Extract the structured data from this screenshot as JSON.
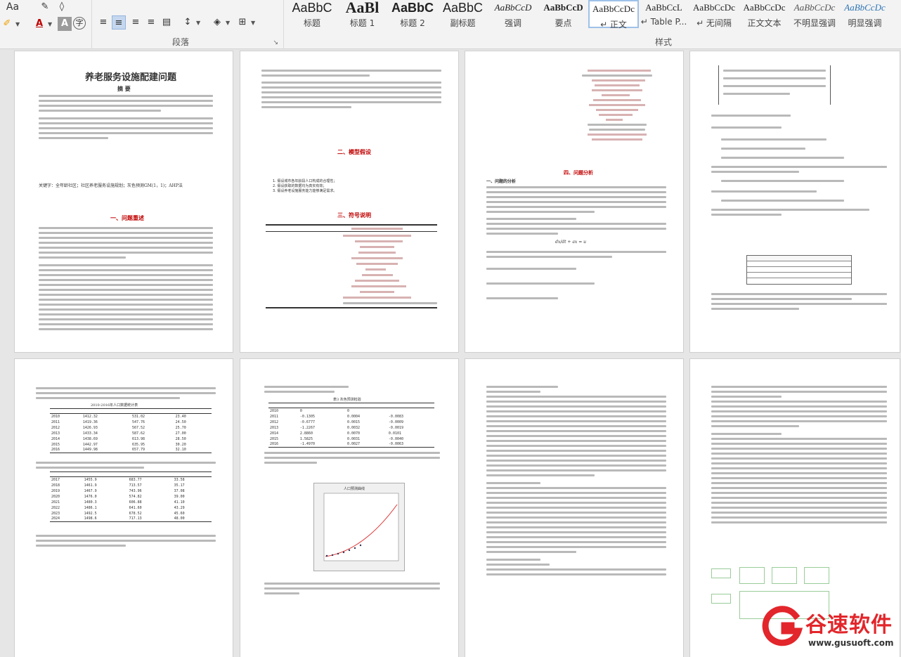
{
  "ribbon": {
    "font_group": {
      "label_partial": "Aa",
      "color_letter": "A",
      "shade_letter": "A",
      "char_letter": "字"
    },
    "paragraph_group": {
      "label": "段落"
    },
    "styles_group": {
      "label": "样式",
      "items": [
        {
          "preview": "AaBbC",
          "name": "标题"
        },
        {
          "preview": "AaBl",
          "name": "标题 1"
        },
        {
          "preview": "AaBbC",
          "name": "标题 2"
        },
        {
          "preview": "AaBbC",
          "name": "副标题"
        },
        {
          "preview": "AaBbCcD",
          "name": "强调"
        },
        {
          "preview": "AaBbCcD",
          "name": "要点"
        },
        {
          "preview": "AaBbCcDc",
          "name": "↵ 正文"
        },
        {
          "preview": "AaBbCcL",
          "name": "↵ Table P..."
        },
        {
          "preview": "AaBbCcDc",
          "name": "↵ 无间隔"
        },
        {
          "preview": "AaBbCcDc",
          "name": "正文文本"
        },
        {
          "preview": "AaBbCcDc",
          "name": "不明显强调"
        },
        {
          "preview": "AaBbCcDc",
          "name": "明显强调"
        }
      ]
    }
  },
  "pages": {
    "p1": {
      "title": "养老服务设施配建问题",
      "abstract_heading": "摘 要",
      "keywords": "关键字：全年龄社区；社区养老服务设施规划；灰色预测GM(1，1)；AHP法",
      "section1": "一、问题重述"
    },
    "p2": {
      "section2": "二、模型假设",
      "assumptions": [
        "1. 假设城市各年龄段人口构成的合理性；",
        "2. 假设获取的数据均为真实有效；",
        "3. 假设养老设施服务能力能够满足需求。"
      ],
      "section3": "三、符号说明"
    },
    "p3": {
      "section4": "四、问题分析",
      "sub1": "一、问题的分析",
      "formula_eq": "dx/dt + ax = u"
    },
    "p5": {
      "table_title": "2010-2016年人口数据统计表",
      "table_rows": [
        [
          "2010",
          "1412.32",
          "531.02",
          "23.40"
        ],
        [
          "2011",
          "1419.36",
          "547.76",
          "24.50"
        ],
        [
          "2012",
          "1426.93",
          "567.52",
          "25.70"
        ],
        [
          "2013",
          "1433.34",
          "587.62",
          "27.00"
        ],
        [
          "2014",
          "1438.69",
          "613.98",
          "28.50"
        ],
        [
          "2015",
          "1442.97",
          "635.95",
          "30.20"
        ],
        [
          "2016",
          "1449.98",
          "657.79",
          "32.10"
        ]
      ],
      "pred_rows": [
        [
          "2017",
          "1455.9",
          "683.77",
          "33.58"
        ],
        [
          "2018",
          "1461.9",
          "713.57",
          "35.17"
        ],
        [
          "2019",
          "1467.9",
          "743.96",
          "37.08"
        ],
        [
          "2020",
          "1476.0",
          "574.82",
          "39.00"
        ],
        [
          "2021",
          "1480.3",
          "606.88",
          "41.10"
        ],
        [
          "2022",
          "1486.1",
          "641.60",
          "43.29"
        ],
        [
          "2023",
          "1492.5",
          "678.52",
          "45.60"
        ],
        [
          "2024",
          "1498.6",
          "717.13",
          "48.00"
        ]
      ]
    },
    "p6": {
      "table_title": "表3  灰色预测检验",
      "rows": [
        [
          "2010",
          "0",
          "0",
          ""
        ],
        [
          "2011",
          "-0.1305",
          "0.0004",
          "-0.0083"
        ],
        [
          "2012",
          "-0.6777",
          "0.0015",
          "-0.0009"
        ],
        [
          "2013",
          "-1.2267",
          "0.0032",
          "-0.0019"
        ],
        [
          "2014",
          "2.8860",
          "0.0070",
          "0.0101"
        ],
        [
          "2015",
          "1.5825",
          "0.0031",
          "-0.0040"
        ],
        [
          "2016",
          "-1.4970",
          "0.0027",
          "-0.0063"
        ]
      ],
      "chart_caption": "人口预测曲线"
    }
  },
  "watermark": {
    "brand": "谷速软件",
    "url": "www.gusuoft.com",
    "color": "#e2262b"
  }
}
